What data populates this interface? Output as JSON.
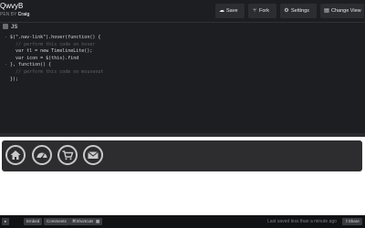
{
  "header": {
    "pen_title": "QwvyB",
    "author_prefix": "PEN BY",
    "author": "Craig",
    "buttons": [
      {
        "label": "Save",
        "icon": "cloud-icon"
      },
      {
        "label": "Fork",
        "icon": "fork-icon"
      },
      {
        "label": "Settings",
        "icon": "gear-icon"
      },
      {
        "label": "Change View",
        "icon": "layout-icon"
      }
    ]
  },
  "editor": {
    "tab_label": "JS",
    "lines": [
      "$(\".nav-link\").hover(function() {",
      "  // perform this code on hover",
      "  var tl = new TimelineLite();",
      "  var icon = $(this).find",
      "}, function() {",
      "  // perform this code on mouseout",
      "});"
    ]
  },
  "footer": {
    "buttons": [
      "Embed",
      "Comments",
      "Shortcuts"
    ],
    "status": "Last saved less than a minute ago",
    "share_label": "Share"
  },
  "colors": {
    "accent": "#e2b93d",
    "background": "#1d1e22"
  }
}
